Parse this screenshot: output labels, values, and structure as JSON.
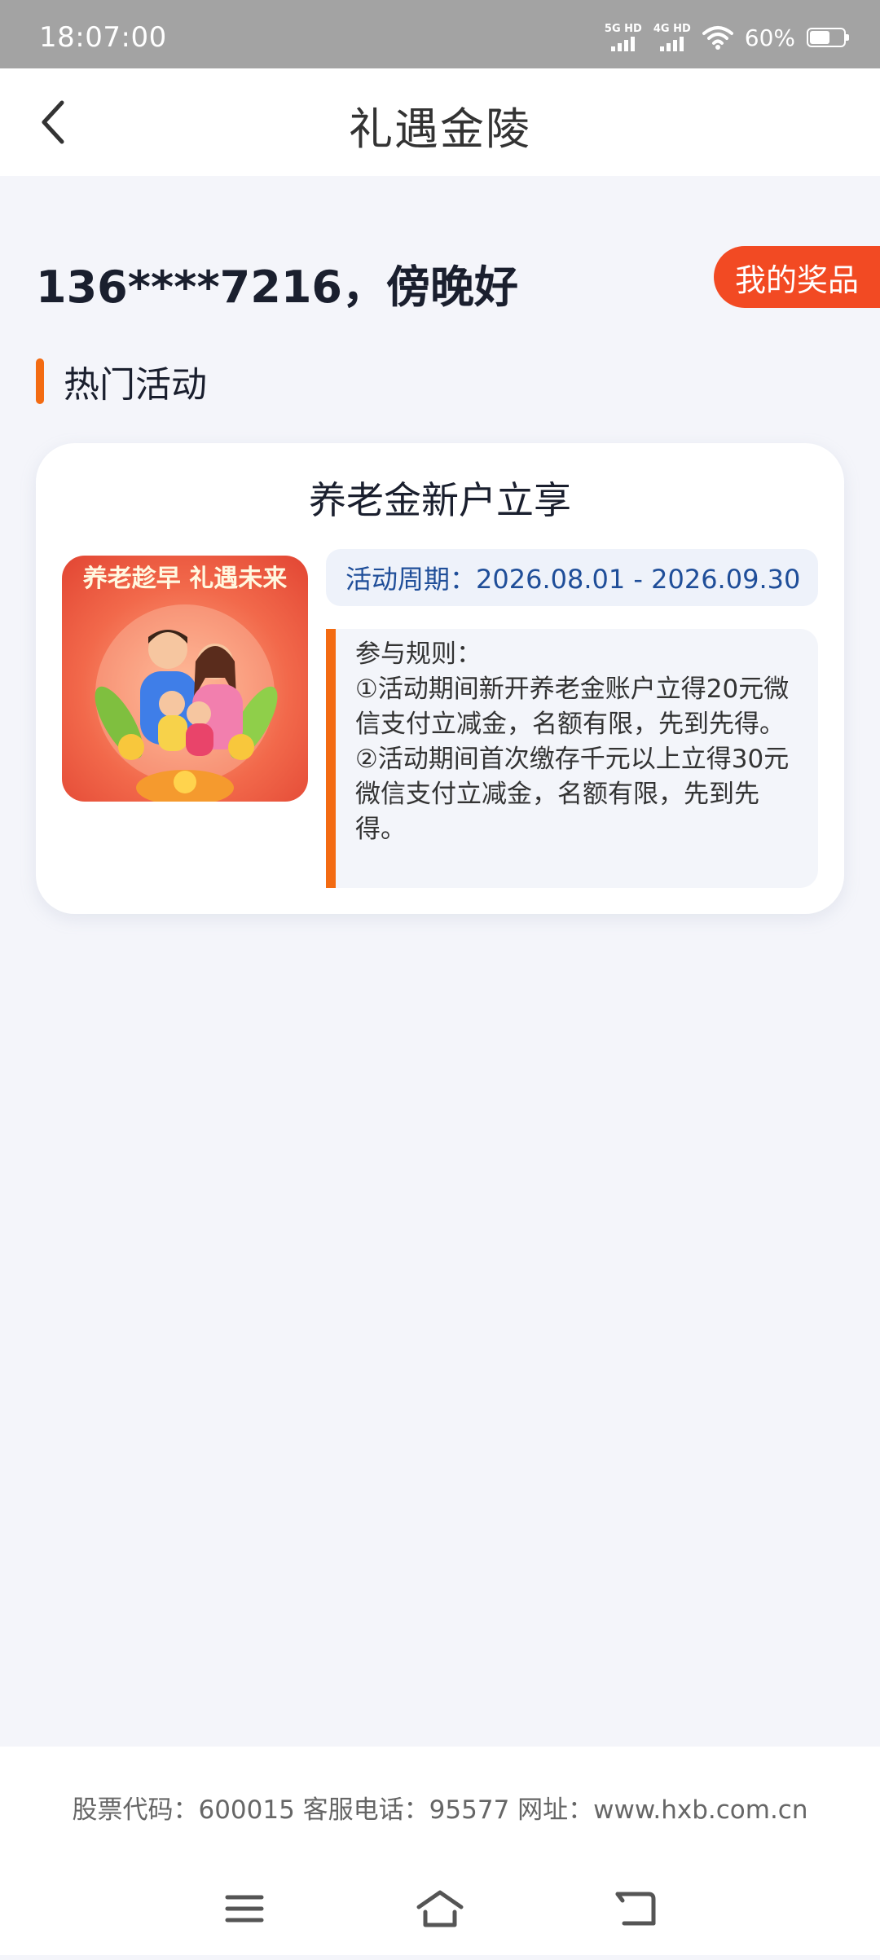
{
  "status_bar": {
    "time": "18:07:00",
    "network1": "5G HD",
    "network2": "4G HD",
    "battery_percent": "60%",
    "battery_level": 0.6
  },
  "header": {
    "title": "礼遇金陵"
  },
  "greeting": "136****7216，傍晚好",
  "prize_button": "我的奖品",
  "section_title": "热门活动",
  "activity_card": {
    "title": "养老金新户立享",
    "image_caption": "养老趁早 礼遇未来",
    "period": "活动周期：2026.08.01 - 2026.09.30",
    "rules_title": "参与规则：",
    "rule_1": "①活动期间新开养老金账户立得20元微信支付立减金，名额有限，先到先得。",
    "rule_2": "②活动期间首次缴存千元以上立得30元微信支付立减金，名额有限，先到先得。"
  },
  "footer": {
    "info": "股票代码：600015 客服电话：95577 网址：www.hxb.com.cn"
  },
  "colors": {
    "accent_orange": "#f36b12",
    "prize_red": "#f24a23",
    "period_blue": "#1f4e99"
  },
  "icons": {
    "back": "chevron-left-icon",
    "menu": "menu-icon",
    "home": "home-icon",
    "return": "return-icon"
  }
}
